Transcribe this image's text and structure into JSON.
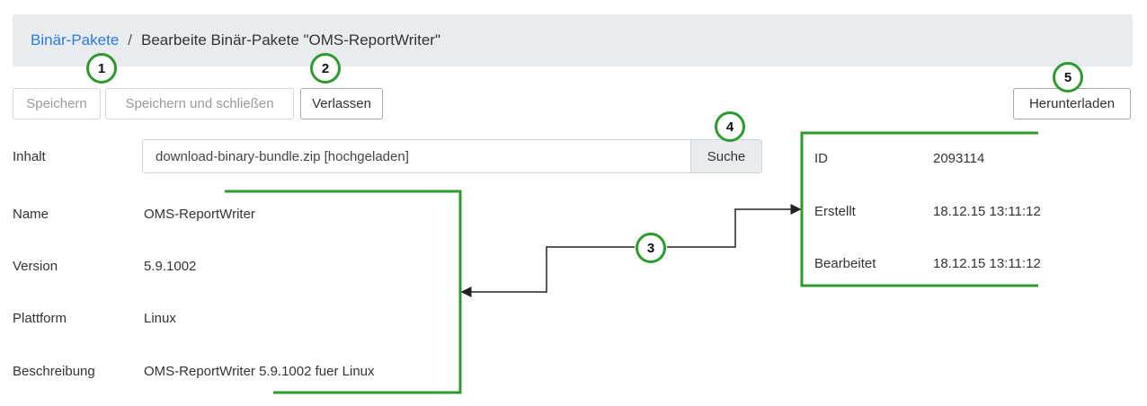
{
  "breadcrumb": {
    "link": "Binär-Pakete",
    "separator": "/",
    "current": "Bearbeite Binär-Pakete \"OMS-ReportWriter\""
  },
  "toolbar": {
    "save": "Speichern",
    "save_close": "Speichern und schließen",
    "leave": "Verlassen",
    "download": "Herunterladen"
  },
  "content": {
    "label": "Inhalt",
    "file_value": "download-binary-bundle.zip [hochgeladen]",
    "search_button": "Suche"
  },
  "fields": {
    "name": {
      "label": "Name",
      "value": "OMS-ReportWriter"
    },
    "version": {
      "label": "Version",
      "value": "5.9.1002"
    },
    "platform": {
      "label": "Plattform",
      "value": "Linux"
    },
    "description": {
      "label": "Beschreibung",
      "value": "OMS-ReportWriter 5.9.1002 fuer Linux"
    }
  },
  "meta": {
    "id": {
      "label": "ID",
      "value": "2093114"
    },
    "created": {
      "label": "Erstellt",
      "value": "18.12.15 13:11:12"
    },
    "edited": {
      "label": "Bearbeitet",
      "value": "18.12.15 13:11:12"
    }
  },
  "callouts": [
    "1",
    "2",
    "3",
    "4",
    "5"
  ],
  "colors": {
    "link": "#2a7ae2",
    "annotation": "#2e9a2e",
    "breadcrumb_bg": "#e9ecef"
  }
}
